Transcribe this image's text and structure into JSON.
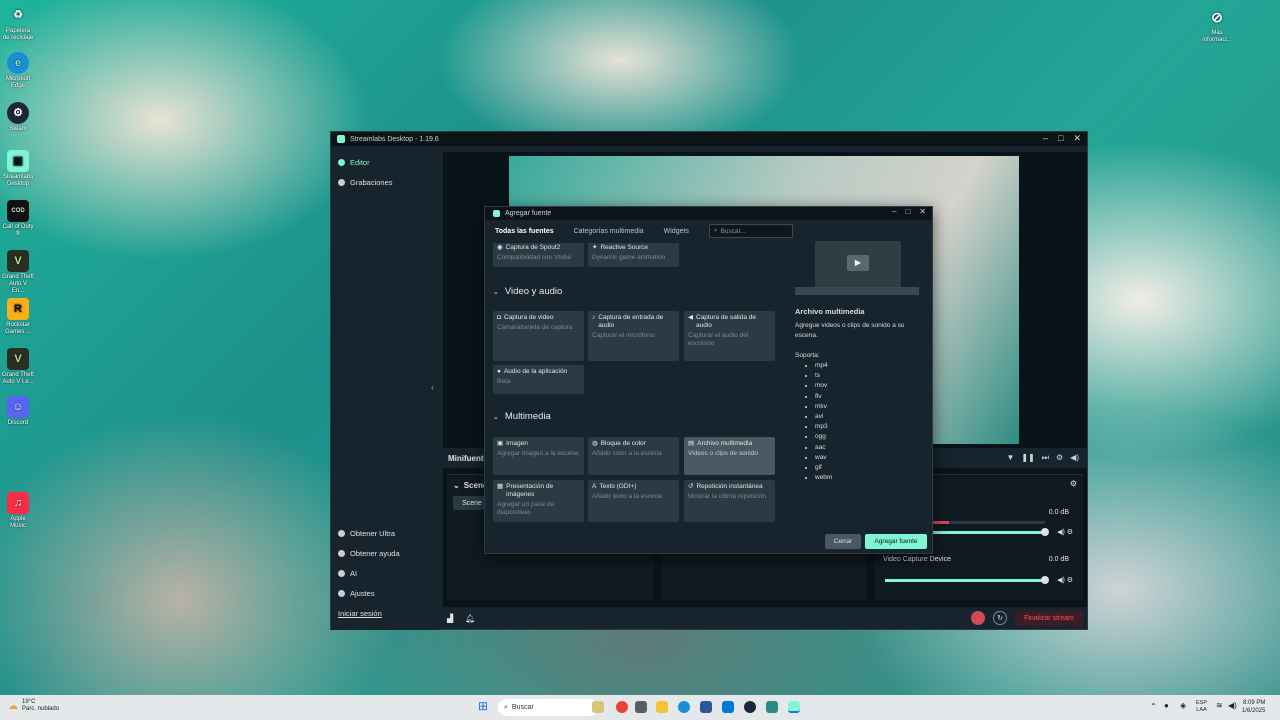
{
  "desktop": {
    "icons": [
      {
        "label": "Papelera de reciclaje",
        "icon": "recycle-bin-icon"
      },
      {
        "label": "Microsoft Edge",
        "icon": "edge-icon"
      },
      {
        "label": "Steam",
        "icon": "steam-icon"
      },
      {
        "label": "Streamlabs Desktop",
        "icon": "streamlabs-icon"
      },
      {
        "label": "Call of Duty ®",
        "icon": "cod-icon"
      },
      {
        "label": "Grand Theft Auto V En...",
        "icon": "gta-icon"
      },
      {
        "label": "Rockstar Games ...",
        "icon": "rockstar-icon"
      },
      {
        "label": "Grand Theft Auto V Le...",
        "icon": "gta-icon"
      },
      {
        "label": "Discord",
        "icon": "discord-icon"
      },
      {
        "label": "Apple Music",
        "icon": "apple-music-icon"
      }
    ],
    "more_info": "Más informaci..."
  },
  "app": {
    "title": "Streamlabs Desktop - 1.19.6",
    "nav": {
      "editor": "Editor",
      "recordings": "Grabaciones"
    },
    "bottom_nav": {
      "ultra": "Obtener Ultra",
      "help": "Obtener ayuda",
      "ai": "AI",
      "settings": "Ajustes",
      "login": "Iniciar sesión"
    },
    "minifuentes": "Minifuente",
    "scenes": {
      "title": "Scenes",
      "scene": "Scene"
    },
    "mixer": {
      "db1": "0.0 dB",
      "device": "Video Capture Device",
      "db2": "0.0 dB"
    },
    "end_stream": "Finalizar stream",
    "accent": "#80f5d2",
    "danger": "#ff4f64"
  },
  "dialog": {
    "title": "Agregar fuente",
    "tabs": [
      "Todas las fuentes",
      "Categorías multimedia",
      "Widgets"
    ],
    "search_placeholder": "Buscar...",
    "top_cards": [
      {
        "title": "Captura de Spout2",
        "desc": "Compatibilidad con Vtube"
      },
      {
        "title": "Reactive Source",
        "desc": "Dynamic game animation"
      }
    ],
    "sections": [
      {
        "title": "Video y audio",
        "cards": [
          {
            "title": "Captura de video",
            "desc": "Cámara/tarjeta de captura"
          },
          {
            "title": "Captura de entrada de audio",
            "desc": "Capturar el micrófono"
          },
          {
            "title": "Captura de salida de audio",
            "desc": "Capturar el audio del escritorio"
          },
          {
            "title": "Audio de la aplicación",
            "desc": "Beta"
          }
        ]
      },
      {
        "title": "Multimedia",
        "cards": [
          {
            "title": "Imagen",
            "desc": "Agregar imagen a la escena"
          },
          {
            "title": "Bloque de color",
            "desc": "Añadir color a la escena"
          },
          {
            "title": "Archivo multimedia",
            "desc": "Videos o clips de sonido"
          },
          {
            "title": "Presentación de imágenes",
            "desc": "Agregar un pase de diapositivas"
          },
          {
            "title": "Texto (GDI+)",
            "desc": "Añadir texto a la escena"
          },
          {
            "title": "Repetición instantánea",
            "desc": "Mostrar la última repetición"
          }
        ]
      }
    ],
    "info": {
      "title": "Archivo multimedia",
      "desc": "Agregue videos o clips de sonido a su escena.",
      "supports_label": "Soporta:",
      "formats": [
        "mp4",
        "ts",
        "mov",
        "flv",
        "mkv",
        "avi",
        "mp3",
        "ogg",
        "aac",
        "wav",
        "gif",
        "webm"
      ]
    },
    "close_button": "Cerrar",
    "add_button": "Agregar fuente"
  },
  "taskbar": {
    "weather_temp": "19°C",
    "weather_desc": "Parc. nublado",
    "search": "Buscar",
    "lang": "ESP",
    "lang2": "LAA",
    "time": "8:09 PM",
    "date": "1/6/2025"
  }
}
